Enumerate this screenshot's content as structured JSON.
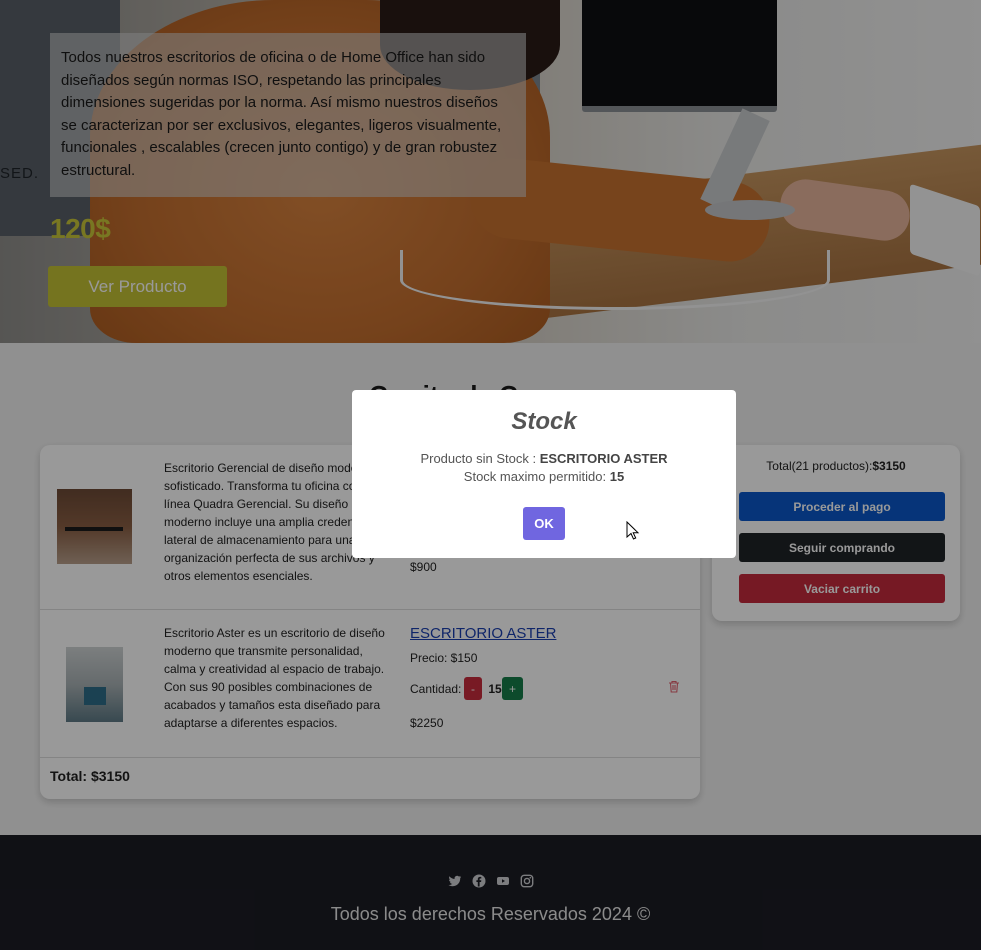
{
  "hero": {
    "background_text": "SED.",
    "description": "Todos nuestros escritorios de oficina o de Home Office han sido diseñados según normas ISO, respetando las principales dimensiones sugeridas por la norma. Así mismo nuestros diseños se caracterizan por ser exclusivos, elegantes, ligeros visualmente, funcionales , escalables (crecen junto contigo) y de gran robustez estructural.",
    "price": "120$",
    "cta_label": "Ver Producto",
    "accent_color": "#c4c234"
  },
  "main": {
    "heading": "Carrito de Compras"
  },
  "cart": {
    "items": [
      {
        "image": "escritorio-gerencial-photo",
        "description": "Escritorio Gerencial de diseño moderno sofisticado. Transforma tu oficina con la línea Quadra Gerencial. Su diseño moderno incluye una amplia credenza lateral de almacenamiento para una organización perfecta de sus archivos y otros elementos esenciales.",
        "subtotal": "$900"
      },
      {
        "image": "escritorio-aster-photo",
        "description": "Escritorio Aster es un escritorio de diseño moderno que transmite personalidad, calma y creatividad al espacio de trabajo. Con sus 90 posibles combinaciones de acabados y tamaños esta diseñado para adaptarse a diferentes espacios.",
        "title": "ESCRITORIO ASTER",
        "price": "Precio: $150",
        "qty_label": "Cantidad:",
        "qty_minus": "-",
        "qty_value": "15",
        "qty_plus": "+",
        "subtotal": "$2250",
        "delete_icon": "trash-icon"
      }
    ],
    "total": "Total: $3150"
  },
  "summary": {
    "total_prefix": "Total(21 productos):",
    "total_value": "$3150",
    "pay_label": "Proceder al pago",
    "continue_label": "Seguir comprando",
    "empty_label": "Vaciar carrito",
    "pay_color": "#0a58ca",
    "continue_color": "#1f2327",
    "empty_color": "#c52b3d"
  },
  "footer": {
    "social_icons": [
      "twitter-icon",
      "facebook-icon",
      "youtube-icon",
      "instagram-icon"
    ],
    "copyright": "Todos los derechos Reservados 2024 ©"
  },
  "modal": {
    "title": "Stock",
    "line1_label": "Producto sin Stock : ",
    "line1_value": "ESCRITORIO ASTER",
    "line2_label": "Stock maximo permitido: ",
    "line2_value": "15",
    "ok_label": "OK",
    "ok_color": "#7066e0"
  }
}
